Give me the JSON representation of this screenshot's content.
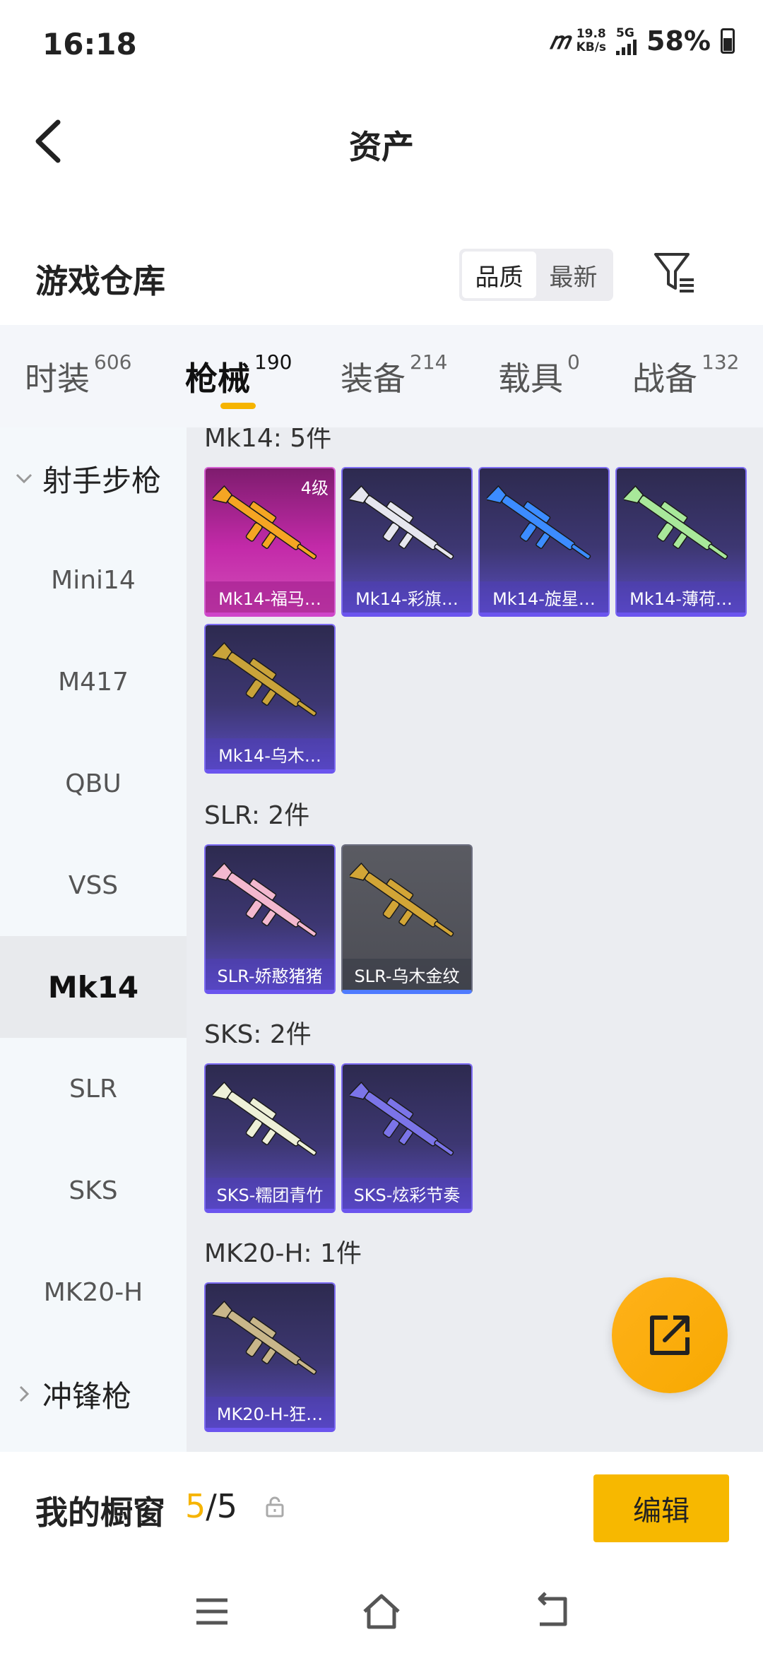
{
  "status": {
    "time": "16:18",
    "logo": "𝑚",
    "speed_value": "19.8",
    "speed_unit": "KB/s",
    "network": "5G",
    "battery": "58%"
  },
  "header": {
    "title": "资产"
  },
  "warehouse": {
    "title": "游戏仓库",
    "sort_options": [
      "品质",
      "最新"
    ]
  },
  "tabs": [
    {
      "label": "时装",
      "count": "606"
    },
    {
      "label": "枪械",
      "count": "190"
    },
    {
      "label": "装备",
      "count": "214"
    },
    {
      "label": "载具",
      "count": "0"
    },
    {
      "label": "战备",
      "count": "132"
    }
  ],
  "sidebar": {
    "group_open": "射手步枪",
    "items": [
      "Mini14",
      "M417",
      "QBU",
      "VSS",
      "Mk14",
      "SLR",
      "SKS",
      "MK20-H"
    ],
    "group_closed": "冲锋枪"
  },
  "sections": [
    {
      "title": "Mk14: 5件",
      "items": [
        {
          "name": "Mk14-福马…",
          "level": "4级",
          "accent": "#f5a523"
        },
        {
          "name": "Mk14-彩旗…",
          "accent": "#e6e6ee"
        },
        {
          "name": "Mk14-旋星…",
          "accent": "#3c8cff"
        },
        {
          "name": "Mk14-薄荷…",
          "accent": "#a8e89a"
        },
        {
          "name": "Mk14-乌木…",
          "accent": "#c9a33a"
        }
      ]
    },
    {
      "title": "SLR: 2件",
      "items": [
        {
          "name": "SLR-娇憨猪猪",
          "accent": "#f3b8cf"
        },
        {
          "name": "SLR-乌木金纹",
          "accent": "#d2a536"
        }
      ]
    },
    {
      "title": "SKS: 2件",
      "items": [
        {
          "name": "SKS-糯团青竹",
          "accent": "#eef0d8"
        },
        {
          "name": "SKS-炫彩节奏",
          "accent": "#7b74e8"
        }
      ]
    },
    {
      "title": "MK20-H: 1件",
      "items": [
        {
          "name": "MK20-H-狂…",
          "accent": "#c8b68a"
        }
      ]
    }
  ],
  "showcase": {
    "label": "我的橱窗",
    "current": "5",
    "total": "/5",
    "edit_label": "编辑"
  },
  "colors": {
    "accent": "#f6b400",
    "card_border": "#6b55ee",
    "sidebar_bg": "#f4f8fb",
    "content_bg": "#ebedf1"
  }
}
